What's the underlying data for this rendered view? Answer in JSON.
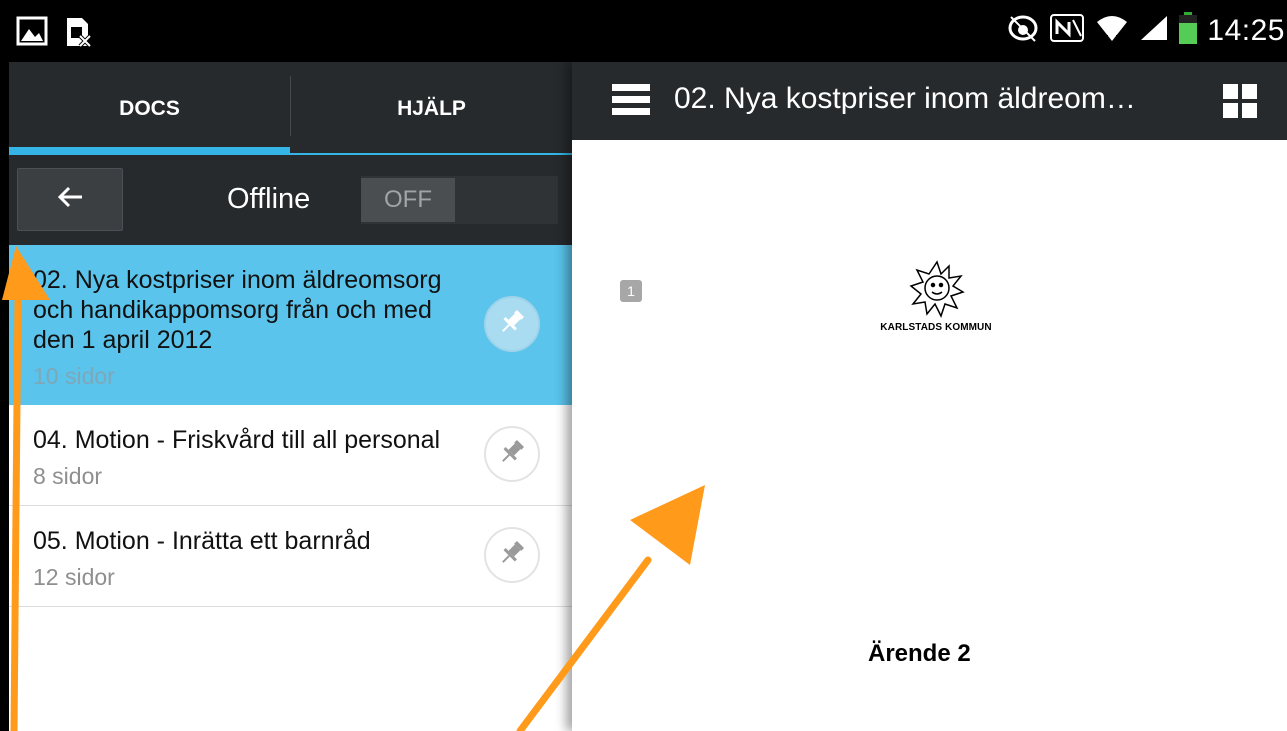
{
  "status_bar": {
    "time": "14:25",
    "left_icons": [
      "gallery-icon",
      "sim-blocked-icon"
    ],
    "right_icons": [
      "eye-icon",
      "nfc-icon",
      "wifi-icon",
      "signal-icon",
      "battery-icon"
    ]
  },
  "tabs": [
    {
      "label": "DOCS",
      "selected": true
    },
    {
      "label": "HJÄLP",
      "selected": false
    }
  ],
  "offline": {
    "label": "Offline",
    "toggle_state": "OFF"
  },
  "documents": [
    {
      "title": "02. Nya kostpriser inom äldreomsorg och handikappomsorg från och med den 1 april 2012",
      "pages": "10 sidor",
      "selected": true
    },
    {
      "title": "04. Motion - Friskvård till all personal",
      "pages": "8 sidor",
      "selected": false
    },
    {
      "title": "05. Motion - Inrätta ett barnråd",
      "pages": "12 sidor",
      "selected": false
    }
  ],
  "viewer": {
    "title": "02. Nya kostpriser inom äldreom…",
    "page_number": "1",
    "organization": "KARLSTADS KOMMUN",
    "case_title": "Ärende 2"
  },
  "colors": {
    "accent": "#34b5e5",
    "selected_row": "#5ac4ec",
    "dark_bar": "#262a2d",
    "annotation_arrow": "#ff9a1a"
  }
}
